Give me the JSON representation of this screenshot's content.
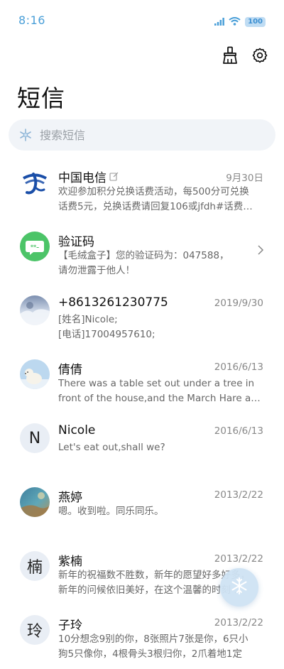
{
  "status": {
    "time": "8:16",
    "battery": "100"
  },
  "header": {
    "title": "短信"
  },
  "search": {
    "placeholder": "搜索短信"
  },
  "messages": [
    {
      "name": "中国电信",
      "date": "9月30日",
      "line1": "欢迎参加积分兑换话费活动，每500分可兑换",
      "line2": "话费5元，兑换话费请回复106或jfdh#话费…",
      "avatar": "china-telecom-logo",
      "has_edit_mark": true
    },
    {
      "name": "验证码",
      "date": "",
      "line1": "【毛绒盒子】您的验证码为：047588，",
      "line2": "请勿泄露于他人！",
      "avatar": "verification-code-icon",
      "has_chevron": true
    },
    {
      "name": "+8613261230775",
      "date": "2019/9/30",
      "line1": "[姓名]Nicole;",
      "line2": "[电话]17004957610;",
      "avatar": "photo-avatar"
    },
    {
      "name": "倩倩",
      "date": "2016/6/13",
      "line1": "There was a table set out under a tree in",
      "line2": "front of the house,and the March Hare an…",
      "avatar": "polar-bear-avatar"
    },
    {
      "name": "Nicole",
      "date": "2016/6/13",
      "line1": "Let's eat out,shall we?",
      "line2": "",
      "avatar": "N"
    },
    {
      "name": "燕婷",
      "date": "2013/2/22",
      "line1": "嗯。收到啦。同乐同乐。",
      "line2": "",
      "avatar": "photo-avatar"
    },
    {
      "name": "紫楠",
      "date": "2013/2/22",
      "line1": "新年的祝福数不胜数，新年的愿望好多好多，",
      "line2": "新年的问候依旧美好，在这个温馨的时刻 …",
      "avatar": "楠"
    },
    {
      "name": "子玲",
      "date": "2013/2/22",
      "line1": "10分想念9别的你，8张照片7张是你，6只小",
      "line2": "狗5只像你，4根骨头3根归你，2爪着地1定",
      "avatar": "玲"
    }
  ],
  "colors": {
    "accent": "#4a9fd8",
    "search_bg": "#f1f4f8",
    "fab_bg": "#cfe3f4"
  }
}
